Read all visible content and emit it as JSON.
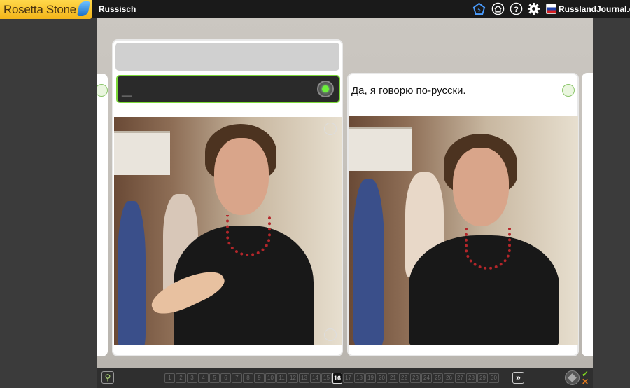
{
  "app": {
    "logo_text": "Rosetta Stone",
    "course": "Russisch"
  },
  "toolbar": {
    "icons": [
      "pentagon-icon",
      "home-icon",
      "help-icon",
      "gear-icon"
    ],
    "journal_label": "RusslandJournal.de"
  },
  "exercise": {
    "prompt_text": "",
    "answer_placeholder": "__",
    "sentence": "Да, я говорю по-русски."
  },
  "pager": {
    "pages": [
      "1",
      "2",
      "3",
      "4",
      "5",
      "6",
      "7",
      "8",
      "9",
      "10",
      "11",
      "12",
      "13",
      "14",
      "15",
      "16",
      "17",
      "18",
      "19",
      "20",
      "21",
      "22",
      "23",
      "24",
      "25",
      "26",
      "27",
      "28",
      "29",
      "30"
    ],
    "current": "16",
    "next_label": "»"
  },
  "status": {
    "correct_mark": "✓",
    "incorrect_mark": "✕"
  },
  "colors": {
    "accent_green": "#7dd93a",
    "logo_yellow": "#f6c22c",
    "topbar": "#1a1a1a"
  }
}
